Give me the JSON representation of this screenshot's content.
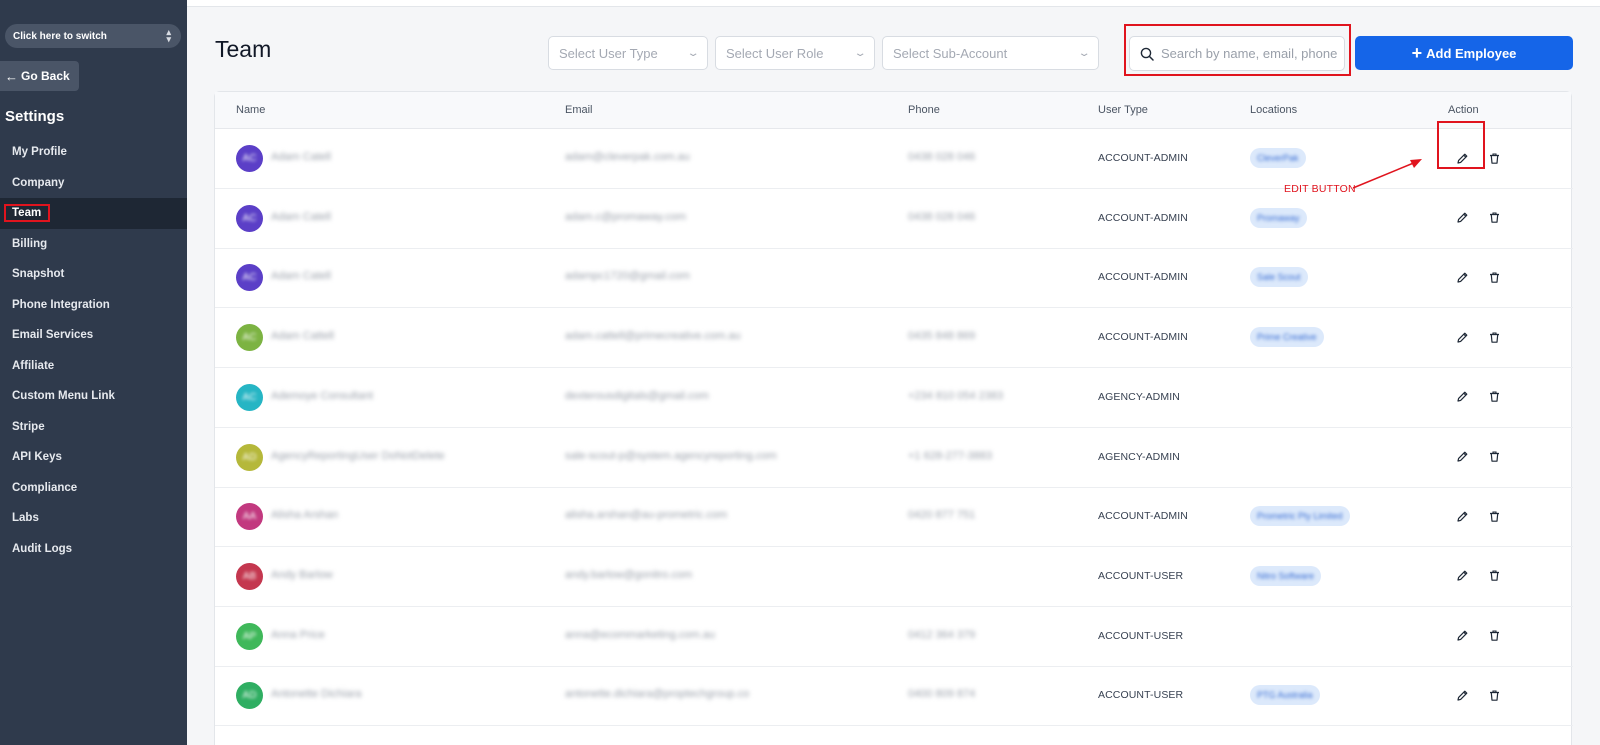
{
  "sidebar": {
    "switcher_label": "Click here to switch",
    "go_back_label": "Go Back",
    "section_title": "Settings",
    "items": [
      {
        "label": "My Profile",
        "active": false
      },
      {
        "label": "Company",
        "active": false
      },
      {
        "label": "Team",
        "active": true
      },
      {
        "label": "Billing",
        "active": false
      },
      {
        "label": "Snapshot",
        "active": false
      },
      {
        "label": "Phone Integration",
        "active": false
      },
      {
        "label": "Email Services",
        "active": false
      },
      {
        "label": "Affiliate",
        "active": false
      },
      {
        "label": "Custom Menu Link",
        "active": false
      },
      {
        "label": "Stripe",
        "active": false
      },
      {
        "label": "API Keys",
        "active": false
      },
      {
        "label": "Compliance",
        "active": false
      },
      {
        "label": "Labs",
        "active": false
      },
      {
        "label": "Audit Logs",
        "active": false
      }
    ]
  },
  "main": {
    "title": "Team",
    "filters": {
      "user_type_placeholder": "Select User Type",
      "user_role_placeholder": "Select User Role",
      "sub_account_placeholder": "Select Sub-Account"
    },
    "search": {
      "placeholder": "Search by name, email, phone"
    },
    "add_button_label": "Add Employee",
    "annotation_label": "EDIT BUTTON"
  },
  "table": {
    "columns": [
      "Name",
      "Email",
      "Phone",
      "User Type",
      "Locations",
      "Action"
    ],
    "rows": [
      {
        "initials": "AC",
        "avatar_color": "#5b3fc7",
        "name": "Adam Catell",
        "email": "adam@cleverpak.com.au",
        "phone": "0438 028 046",
        "user_type": "ACCOUNT-ADMIN",
        "location": "CleverPak"
      },
      {
        "initials": "AC",
        "avatar_color": "#5b3fc7",
        "name": "Adam Catell",
        "email": "adam.c@promaway.com",
        "phone": "0438 028 046",
        "user_type": "ACCOUNT-ADMIN",
        "location": "Promaway"
      },
      {
        "initials": "AC",
        "avatar_color": "#5b3fc7",
        "name": "Adam Catell",
        "email": "adampc1720@gmail.com",
        "phone": "",
        "user_type": "ACCOUNT-ADMIN",
        "location": "Sale Scout"
      },
      {
        "initials": "AC",
        "avatar_color": "#7cb342",
        "name": "Adam Cattell",
        "email": "adam.cattell@primecreative.com.au",
        "phone": "0435 848 869",
        "user_type": "ACCOUNT-ADMIN",
        "location": "Prime Creative"
      },
      {
        "initials": "AC",
        "avatar_color": "#26b5c4",
        "name": "Ademoye Consultant",
        "email": "dexterousdigitals@gmail.com",
        "phone": "+234 810 054 2383",
        "user_type": "AGENCY-ADMIN",
        "location": ""
      },
      {
        "initials": "AD",
        "avatar_color": "#b5b83a",
        "name": "AgencyReportingUser DoNotDelete",
        "email": "sale-scout-p@system.agencyreporting.com",
        "phone": "+1 628-277-3883",
        "user_type": "AGENCY-ADMIN",
        "location": ""
      },
      {
        "initials": "AA",
        "avatar_color": "#c2397f",
        "name": "Alisha Arshan",
        "email": "alisha.arshan@au-prometric.com",
        "phone": "0420 877 751",
        "user_type": "ACCOUNT-ADMIN",
        "location": "Prometric Pty Limited"
      },
      {
        "initials": "AB",
        "avatar_color": "#c4374f",
        "name": "Andy Barlow",
        "email": "andy.barlow@gonitro.com",
        "phone": "",
        "user_type": "ACCOUNT-USER",
        "location": "Nitro Software"
      },
      {
        "initials": "AP",
        "avatar_color": "#3fb85a",
        "name": "Anna Price",
        "email": "anna@ecommarketing.com.au",
        "phone": "0412 364 379",
        "user_type": "ACCOUNT-USER",
        "location": ""
      },
      {
        "initials": "AD",
        "avatar_color": "#2fae62",
        "name": "Antonette Dichiara",
        "email": "antonette.dichiara@proptechgroup.co",
        "phone": "0400 809 874",
        "user_type": "ACCOUNT-USER",
        "location": "PTG Australia"
      }
    ]
  },
  "icons": {
    "search": "search-icon",
    "edit": "pencil-icon",
    "delete": "trash-icon",
    "back": "arrow-left-icon",
    "add": "plus-icon"
  },
  "colors": {
    "sidebar_bg": "#2f3a4c",
    "primary": "#1565e8",
    "annotation": "#e0141e"
  }
}
